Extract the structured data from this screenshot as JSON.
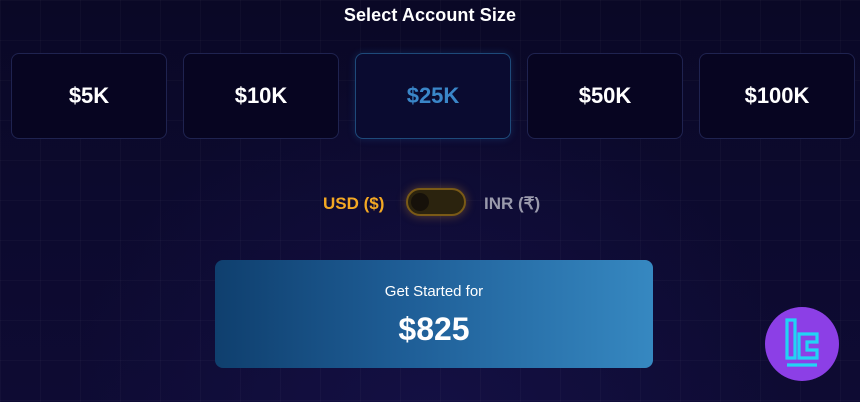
{
  "header": {
    "title": "Select Account Size"
  },
  "account_sizes": [
    {
      "label": "$5K",
      "selected": false
    },
    {
      "label": "$10K",
      "selected": false
    },
    {
      "label": "$25K",
      "selected": true
    },
    {
      "label": "$50K",
      "selected": false
    },
    {
      "label": "$100K",
      "selected": false
    }
  ],
  "currency": {
    "left_label": "USD ($)",
    "right_label": "INR (₹)",
    "active": "USD ($)"
  },
  "cta": {
    "label": "Get Started for",
    "price": "$825"
  },
  "logo": {
    "icon": "brand-logo-icon"
  },
  "colors": {
    "background": "#0c0a2e",
    "selected_accent": "#3a86c8",
    "currency_active": "#f3a823",
    "currency_inactive": "#9a9aac",
    "cta_gradient_start": "#0f3f6e",
    "cta_gradient_end": "#3688c1",
    "logo_bg": "#8c3fe6",
    "logo_stroke": "#22d3f5"
  }
}
